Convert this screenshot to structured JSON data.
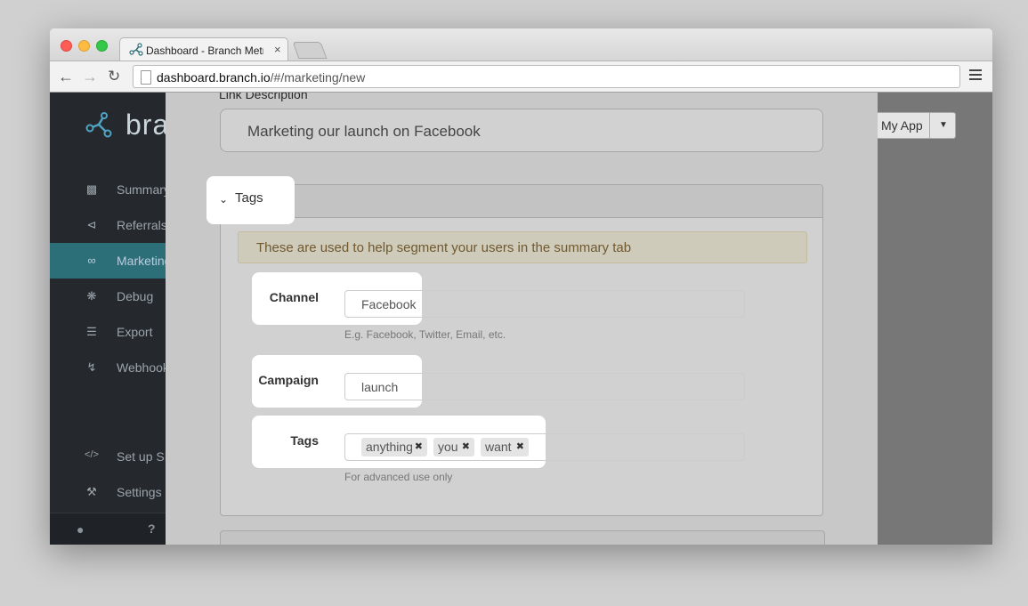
{
  "browser": {
    "tab_title": "Dashboard - Branch Metrics",
    "tab_close": "×",
    "url_host": "dashboard.branch.io",
    "url_path": "/#/marketing/new"
  },
  "sidebar": {
    "brand": "bra",
    "items": [
      {
        "label": "Summary",
        "icon": "bar-chart-icon"
      },
      {
        "label": "Referrals",
        "icon": "share-icon"
      },
      {
        "label": "Marketing",
        "icon": "link-icon"
      },
      {
        "label": "Debug",
        "icon": "bug-icon"
      },
      {
        "label": "Export",
        "icon": "database-icon"
      },
      {
        "label": "Webhooks",
        "icon": "bolt-icon"
      },
      {
        "label": "Set up SDK",
        "icon": "code-icon"
      },
      {
        "label": "Settings",
        "icon": "wrench-icon"
      }
    ],
    "active_item": "Marketing",
    "help_label": "?"
  },
  "app_switcher": {
    "label": "My App"
  },
  "form": {
    "description_label": "Link Description",
    "description_value": "Marketing our launch on Facebook",
    "tags_section_title": "Tags",
    "tags_info": "These are used to help segment your users in the summary tab",
    "channel_label": "Channel",
    "channel_value": "Facebook",
    "channel_help": "E.g. Facebook, Twitter, Email, etc.",
    "campaign_label": "Campaign",
    "campaign_value": "launch",
    "tags_label": "Tags",
    "tags": [
      "anything",
      "you",
      "want"
    ],
    "tags_help": "For advanced use only"
  },
  "colors": {
    "sidebar_bg": "#25292e",
    "sidebar_active": "#2c6f78",
    "alert_bg": "#fcf8e3",
    "alert_text": "#8a6d3b"
  }
}
